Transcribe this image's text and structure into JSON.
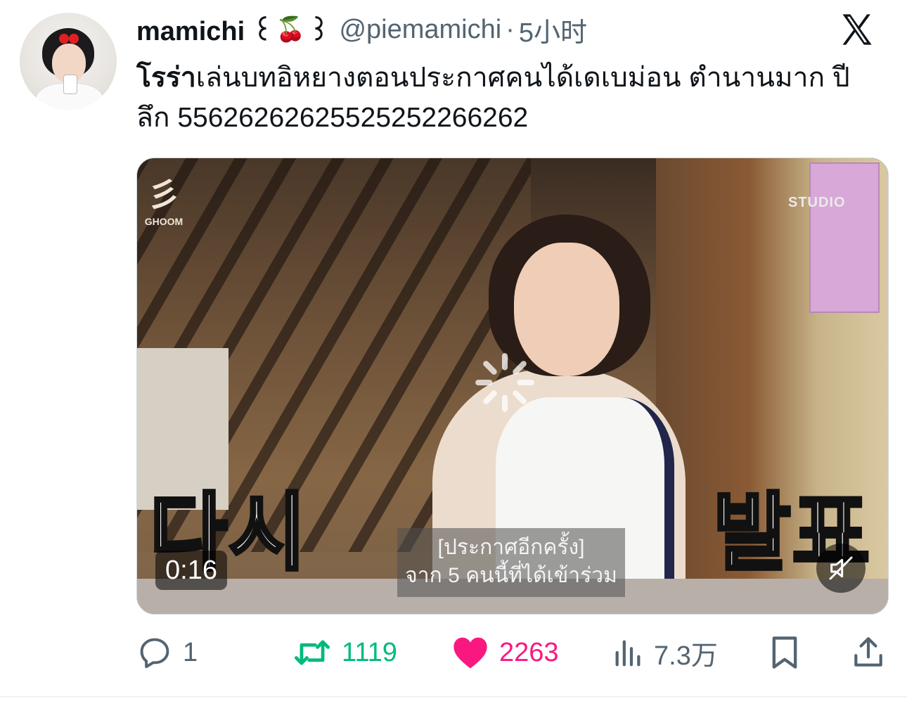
{
  "author": {
    "display_name": "mamichi ꒰",
    "emoji": "🍒",
    "name_suffix": "꒱",
    "handle": "@piemamichi",
    "separator": "·",
    "time": "5小时"
  },
  "tweet": {
    "bold_text": "โรร่า",
    "text": "เล่นบทอิหยางตอนประกาศคนได้เดเบม่อน ตำนานมาก ปีลึก 55626262625525252266262"
  },
  "media": {
    "overlay_left": "다시",
    "overlay_right": "발표",
    "caption_line1": "[ประกาศอีกครั้ง]",
    "caption_line2": "จาก 5 คนนี้ที่ได้เข้าร่วม",
    "duration": "0:16",
    "logo_left": "GHOOM",
    "logo_right": "STUDIO"
  },
  "actions": {
    "replies": "1",
    "retweets": "1119",
    "likes": "2263",
    "views": "7.3万"
  },
  "colors": {
    "retweet": "#00ba7c",
    "like": "#f91880",
    "muted": "#536471"
  }
}
